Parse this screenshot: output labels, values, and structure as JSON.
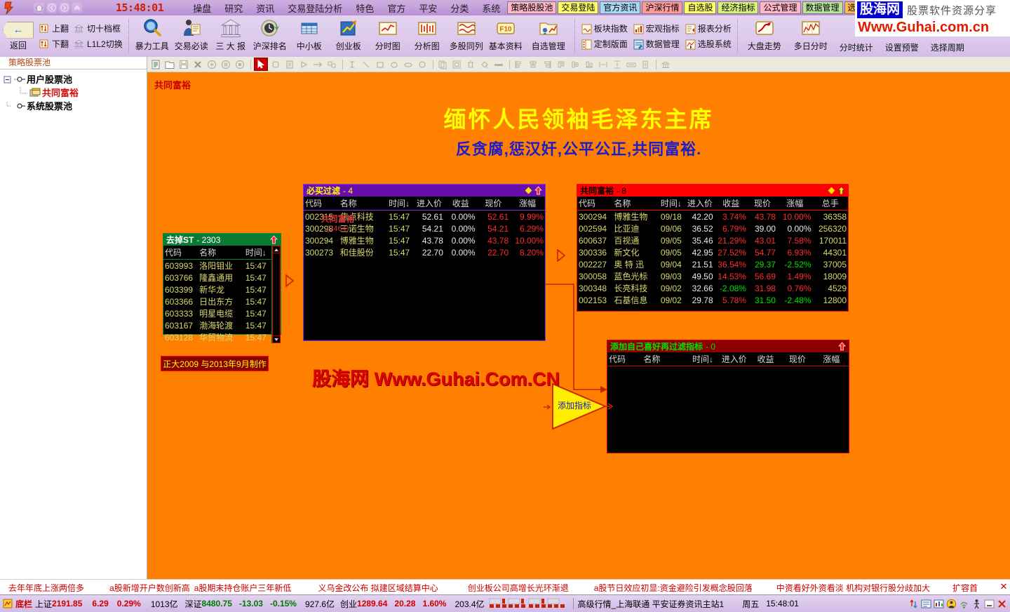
{
  "menubar": {
    "clock": "15:48:01",
    "items": [
      {
        "label": "操盘",
        "active": true
      },
      {
        "label": "研究",
        "active": false
      },
      {
        "label": "资讯",
        "active": false
      },
      {
        "label": "交易登陆分析",
        "active": false
      },
      {
        "label": "特色",
        "active": false
      },
      {
        "label": "官方",
        "active": false
      },
      {
        "label": "平安",
        "active": false
      },
      {
        "label": "分类",
        "active": false
      },
      {
        "label": "系统",
        "active": false
      }
    ],
    "tags": [
      {
        "label": "策略股股池",
        "color": "t-pink"
      },
      {
        "label": "交易登陆",
        "color": "t-yellow"
      },
      {
        "label": "官方资讯",
        "color": "t-blue"
      },
      {
        "label": "沪深行情",
        "color": "t-red"
      },
      {
        "label": "自选股",
        "color": "t-yellow"
      },
      {
        "label": "经济指标",
        "color": "t-lime"
      },
      {
        "label": "公式管理",
        "color": "t-pink"
      },
      {
        "label": "数据管理",
        "color": "t-green"
      },
      {
        "label": "选股",
        "color": "t-orange"
      }
    ]
  },
  "brand": {
    "logo": "股海网",
    "sub": "股票软件资源分享",
    "url": "Www.Guhai.com.cn"
  },
  "toolbar": {
    "back_label": "返回",
    "stack1": [
      {
        "icon": "updown-icon",
        "label": "上翻"
      },
      {
        "icon": "updown-icon",
        "label": "下翻"
      }
    ],
    "stack2": [
      {
        "icon": "bank-icon",
        "label": "切十档框"
      },
      {
        "icon": "bank-icon",
        "label": "L1L2切换"
      }
    ],
    "big": [
      {
        "icon": "magnifier-icon",
        "label": "暴力工具"
      },
      {
        "icon": "person-book-icon",
        "label": "交易必读"
      },
      {
        "icon": "bank-icon",
        "label": "三 大 报"
      },
      {
        "icon": "clock-refresh-icon",
        "label": "沪深排名"
      },
      {
        "icon": "grid-blue-icon",
        "label": "中小板"
      },
      {
        "icon": "chart-arrow-icon",
        "label": "创业板"
      },
      {
        "icon": "line-chart-icon",
        "label": "分时图"
      },
      {
        "icon": "candle-icon",
        "label": "分析图"
      },
      {
        "icon": "multiwave-icon",
        "label": "多股同列"
      },
      {
        "icon": "f10-icon",
        "label": "基本资料"
      },
      {
        "icon": "folder-chart-icon",
        "label": "自选管理"
      }
    ],
    "stack3": [
      {
        "icon": "sector-index-icon",
        "label": "板块指数"
      },
      {
        "icon": "layout-icon",
        "label": "定制版面"
      }
    ],
    "stack4": [
      {
        "icon": "macro-icon",
        "label": "宏观指标"
      },
      {
        "icon": "datamgr-icon",
        "label": "数据管理"
      }
    ],
    "stack5": [
      {
        "icon": "report-icon",
        "label": "报表分析"
      },
      {
        "icon": "pickstock-icon",
        "label": "选股系统"
      }
    ],
    "big2": [
      {
        "icon": "uptrend-icon",
        "label": "大盘走势"
      },
      {
        "icon": "multiday-icon",
        "label": "多日分时"
      }
    ],
    "tail": [
      "分时统计",
      "设置预警",
      "选择周期"
    ]
  },
  "drawbar": {
    "buttons": [
      "new-doc-icon",
      "open-folder-icon",
      "save-icon",
      "delete-x-icon",
      "play-icon",
      "pause-icon",
      "stop-icon",
      "select-arrow-icon",
      "rounded-rect-icon",
      "document-icon",
      "triangle-icon",
      "arrow-right-icon",
      "flowbox-icon",
      "text-icon",
      "line-icon",
      "square-icon",
      "rounded-shape-icon",
      "ellipse-icon",
      "circle-icon",
      "copy-icon",
      "paste-icon",
      "trash-icon",
      "fill-icon",
      "minus-bar-icon",
      "align-left-icon",
      "align-center-icon",
      "align-right-icon",
      "align-top-icon",
      "align-middle-icon",
      "align-bottom-icon",
      "dist-h-icon",
      "dist-v-icon",
      "same-width-icon",
      "same-height-icon",
      "bank-small-icon"
    ]
  },
  "sidebar": {
    "tab": "策略股票池",
    "tree": [
      {
        "label": "用户股票池",
        "depth": 0,
        "type": "root",
        "red": false
      },
      {
        "label": "共同富裕",
        "depth": 1,
        "type": "folder",
        "red": true
      },
      {
        "label": "系统股票池",
        "depth": 0,
        "type": "root2",
        "red": false
      }
    ]
  },
  "canvas": {
    "title": "共同富裕",
    "headline": "缅怀人民领袖毛泽东主席",
    "subhead": "反贪腐,惩汉奸,公平公正,共同富裕.",
    "watermark": "股海网 Www.Guhai.Com.CN",
    "credit": "正大2009  与2013年9月制作",
    "add_index_label": "添加指标",
    "cylinder": {
      "name": "共同富裕",
      "count": "(2464)"
    }
  },
  "windows": {
    "bimai": {
      "title": "必买过滤",
      "count": "- 4",
      "columns": [
        "代码",
        "名称",
        "时间↓",
        "进入价",
        "收益",
        "现价",
        "涨幅"
      ],
      "rows": [
        {
          "code": "002315",
          "name": "焦点科技",
          "time": "15:47",
          "entry": "52.61",
          "profit": "0.00%",
          "price": "52.61",
          "chg": "9.99%",
          "price_cls": "c-up",
          "chg_cls": "c-up",
          "profit_cls": "c-white"
        },
        {
          "code": "300298",
          "name": "三诺生物",
          "time": "15:47",
          "entry": "54.21",
          "profit": "0.00%",
          "price": "54.21",
          "chg": "6.29%",
          "price_cls": "c-up",
          "chg_cls": "c-up",
          "profit_cls": "c-white"
        },
        {
          "code": "300294",
          "name": "博雅生物",
          "time": "15:47",
          "entry": "43.78",
          "profit": "0.00%",
          "price": "43.78",
          "chg": "10.00%",
          "price_cls": "c-up",
          "chg_cls": "c-up",
          "profit_cls": "c-white"
        },
        {
          "code": "300273",
          "name": "和佳股份",
          "time": "15:47",
          "entry": "22.70",
          "profit": "0.00%",
          "price": "22.70",
          "chg": "8.20%",
          "price_cls": "c-up",
          "chg_cls": "c-up",
          "profit_cls": "c-white"
        }
      ]
    },
    "gtfy": {
      "title": "共同富裕",
      "count": "- 8",
      "columns": [
        "代码",
        "名称",
        "时间↓",
        "进入价",
        "收益",
        "现价",
        "涨幅",
        "总手"
      ],
      "rows": [
        {
          "code": "300294",
          "name": "博雅生物",
          "time": "09/18",
          "entry": "42.20",
          "profit": "3.74%",
          "price": "43.78",
          "chg": "10.00%",
          "vol": "36358",
          "profit_cls": "c-up",
          "price_cls": "c-up",
          "chg_cls": "c-up"
        },
        {
          "code": "002594",
          "name": "比亚迪",
          "time": "09/06",
          "entry": "36.52",
          "profit": "6.79%",
          "price": "39.00",
          "chg": "0.00%",
          "vol": "256320",
          "profit_cls": "c-up",
          "price_cls": "c-white",
          "chg_cls": "c-white"
        },
        {
          "code": "600637",
          "name": "百视通",
          "time": "09/05",
          "entry": "35.46",
          "profit": "21.29%",
          "price": "43.01",
          "chg": "7.58%",
          "vol": "170011",
          "profit_cls": "c-up",
          "price_cls": "c-up",
          "chg_cls": "c-up"
        },
        {
          "code": "300336",
          "name": "新文化",
          "time": "09/05",
          "entry": "42.95",
          "profit": "27.52%",
          "price": "54.77",
          "chg": "6.93%",
          "vol": "44301",
          "profit_cls": "c-up",
          "price_cls": "c-up",
          "chg_cls": "c-up"
        },
        {
          "code": "002227",
          "name": "奥 特 迅",
          "time": "09/04",
          "entry": "21.51",
          "profit": "36.54%",
          "price": "29.37",
          "chg": "-2.52%",
          "vol": "37005",
          "profit_cls": "c-up",
          "price_cls": "c-down",
          "chg_cls": "c-down"
        },
        {
          "code": "300058",
          "name": "蓝色光标",
          "time": "09/03",
          "entry": "49.50",
          "profit": "14.53%",
          "price": "56.69",
          "chg": "1.49%",
          "vol": "18009",
          "profit_cls": "c-up",
          "price_cls": "c-up",
          "chg_cls": "c-up"
        },
        {
          "code": "300348",
          "name": "长亮科技",
          "time": "09/02",
          "entry": "32.66",
          "profit": "-2.08%",
          "price": "31.98",
          "chg": "0.76%",
          "vol": "4529",
          "profit_cls": "c-down",
          "price_cls": "c-up",
          "chg_cls": "c-up"
        },
        {
          "code": "002153",
          "name": "石基信息",
          "time": "09/02",
          "entry": "29.78",
          "profit": "5.78%",
          "price": "31.50",
          "chg": "-2.48%",
          "vol": "12800",
          "profit_cls": "c-up",
          "price_cls": "c-down",
          "chg_cls": "c-down"
        }
      ]
    },
    "addfilter": {
      "title": "添加自己喜好再过滤指标",
      "count": "- 0",
      "columns": [
        "代码",
        "名称",
        "时间↓",
        "进入价",
        "收益",
        "现价",
        "涨幅"
      ],
      "rows": []
    },
    "st": {
      "title": "去掉ST",
      "count": "- 2303",
      "columns": [
        "代码",
        "名称",
        "时间↓"
      ],
      "rows": [
        {
          "code": "603993",
          "name": "洛阳钼业",
          "time": "15:47"
        },
        {
          "code": "603766",
          "name": "隆鑫通用",
          "time": "15:47"
        },
        {
          "code": "603399",
          "name": "新华龙",
          "time": "15:47"
        },
        {
          "code": "603366",
          "name": "日出东方",
          "time": "15:47"
        },
        {
          "code": "603333",
          "name": "明星电缆",
          "time": "15:47"
        },
        {
          "code": "603167",
          "name": "渤海轮渡",
          "time": "15:47"
        },
        {
          "code": "603128",
          "name": "华贸物流",
          "time": "15:47"
        }
      ]
    }
  },
  "ticker": {
    "items": [
      "去年年底上涨两倍多",
      "a股新增开户数创新高",
      "a股期末持仓账户三年新低",
      "义乌金改公布 拟建区域结算中心",
      "创业板公司高增长光环渐退",
      "a股节日效应初显:资金避险引发概念股回落",
      "中资看好外资看淡 机构对银行股分歧加大",
      "扩容首"
    ],
    "close": "✕"
  },
  "status": {
    "label": "底栏",
    "indices": [
      {
        "name": "上证",
        "value": "2191.85",
        "chg": "6.29",
        "pct": "0.29%",
        "amount": "1013亿",
        "dir": "up"
      },
      {
        "name": "深证",
        "value": "8480.75",
        "chg": "-13.03",
        "pct": "-0.15%",
        "amount": "927.6亿",
        "dir": "down"
      },
      {
        "name": "创业",
        "value": "1289.64",
        "chg": "20.28",
        "pct": "1.60%",
        "amount": "203.4亿",
        "dir": "up"
      }
    ],
    "connection": "高级行情_上海联通  平安证券资讯主站1",
    "weekday": "周五",
    "time": "15:48:01"
  },
  "colors": {
    "canvas_bg": "#ff7f00",
    "headline": "#ffff00",
    "subhead": "#1c1ccc",
    "up": "#ff2b2b",
    "down": "#00e000",
    "purple_title": "#6a0dad",
    "red_title": "#ff0000",
    "green_title": "#0b7a33"
  }
}
